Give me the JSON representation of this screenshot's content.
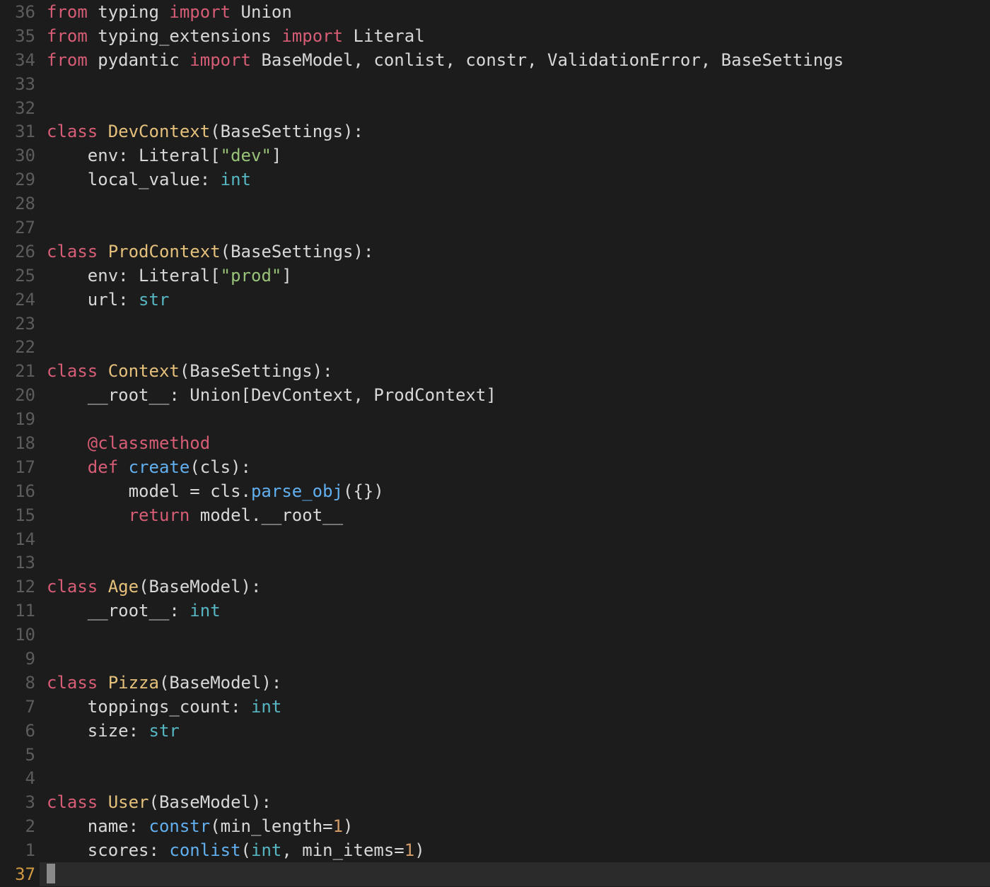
{
  "current_line_index": 36,
  "lines": [
    {
      "num": "36",
      "tokens": [
        {
          "cls": "tk-kw1",
          "t": "from"
        },
        {
          "cls": "tk-def",
          "t": " typing "
        },
        {
          "cls": "tk-kw1",
          "t": "import"
        },
        {
          "cls": "tk-def",
          "t": " Union"
        }
      ]
    },
    {
      "num": "35",
      "tokens": [
        {
          "cls": "tk-kw1",
          "t": "from"
        },
        {
          "cls": "tk-def",
          "t": " typing_extensions "
        },
        {
          "cls": "tk-kw1",
          "t": "import"
        },
        {
          "cls": "tk-def",
          "t": " Literal"
        }
      ]
    },
    {
      "num": "34",
      "tokens": [
        {
          "cls": "tk-kw1",
          "t": "from"
        },
        {
          "cls": "tk-def",
          "t": " pydantic "
        },
        {
          "cls": "tk-kw1",
          "t": "import"
        },
        {
          "cls": "tk-def",
          "t": " BaseModel, conlist, constr, ValidationError, BaseSettings"
        }
      ]
    },
    {
      "num": "33",
      "tokens": []
    },
    {
      "num": "32",
      "tokens": []
    },
    {
      "num": "31",
      "tokens": [
        {
          "cls": "tk-kw1",
          "t": "class"
        },
        {
          "cls": "tk-def",
          "t": " "
        },
        {
          "cls": "tk-cls",
          "t": "DevContext"
        },
        {
          "cls": "tk-def",
          "t": "(BaseSettings):"
        }
      ]
    },
    {
      "num": "30",
      "tokens": [
        {
          "cls": "tk-def",
          "t": "    env: Literal["
        },
        {
          "cls": "tk-str",
          "t": "\"dev\""
        },
        {
          "cls": "tk-def",
          "t": "]"
        }
      ]
    },
    {
      "num": "29",
      "tokens": [
        {
          "cls": "tk-def",
          "t": "    local_value: "
        },
        {
          "cls": "tk-type",
          "t": "int"
        }
      ]
    },
    {
      "num": "28",
      "tokens": []
    },
    {
      "num": "27",
      "tokens": []
    },
    {
      "num": "26",
      "tokens": [
        {
          "cls": "tk-kw1",
          "t": "class"
        },
        {
          "cls": "tk-def",
          "t": " "
        },
        {
          "cls": "tk-cls",
          "t": "ProdContext"
        },
        {
          "cls": "tk-def",
          "t": "(BaseSettings):"
        }
      ]
    },
    {
      "num": "25",
      "tokens": [
        {
          "cls": "tk-def",
          "t": "    env: Literal["
        },
        {
          "cls": "tk-str",
          "t": "\"prod\""
        },
        {
          "cls": "tk-def",
          "t": "]"
        }
      ]
    },
    {
      "num": "24",
      "tokens": [
        {
          "cls": "tk-def",
          "t": "    url: "
        },
        {
          "cls": "tk-type",
          "t": "str"
        }
      ]
    },
    {
      "num": "23",
      "tokens": []
    },
    {
      "num": "22",
      "tokens": []
    },
    {
      "num": "21",
      "tokens": [
        {
          "cls": "tk-kw1",
          "t": "class"
        },
        {
          "cls": "tk-def",
          "t": " "
        },
        {
          "cls": "tk-cls",
          "t": "Context"
        },
        {
          "cls": "tk-def",
          "t": "(BaseSettings):"
        }
      ]
    },
    {
      "num": "20",
      "tokens": [
        {
          "cls": "tk-def",
          "t": "    __root__: Union[DevContext, ProdContext]"
        }
      ]
    },
    {
      "num": "19",
      "tokens": []
    },
    {
      "num": "18",
      "tokens": [
        {
          "cls": "tk-def",
          "t": "    "
        },
        {
          "cls": "tk-decor",
          "t": "@classmethod"
        }
      ]
    },
    {
      "num": "17",
      "tokens": [
        {
          "cls": "tk-def",
          "t": "    "
        },
        {
          "cls": "tk-kw1",
          "t": "def"
        },
        {
          "cls": "tk-def",
          "t": " "
        },
        {
          "cls": "tk-fn",
          "t": "create"
        },
        {
          "cls": "tk-def",
          "t": "(cls):"
        }
      ]
    },
    {
      "num": "16",
      "tokens": [
        {
          "cls": "tk-def",
          "t": "        model = cls."
        },
        {
          "cls": "tk-fn",
          "t": "parse_obj"
        },
        {
          "cls": "tk-def",
          "t": "({})"
        }
      ]
    },
    {
      "num": "15",
      "tokens": [
        {
          "cls": "tk-def",
          "t": "        "
        },
        {
          "cls": "tk-kw1",
          "t": "return"
        },
        {
          "cls": "tk-def",
          "t": " model.__root__"
        }
      ]
    },
    {
      "num": "14",
      "tokens": []
    },
    {
      "num": "13",
      "tokens": []
    },
    {
      "num": "12",
      "tokens": [
        {
          "cls": "tk-kw1",
          "t": "class"
        },
        {
          "cls": "tk-def",
          "t": " "
        },
        {
          "cls": "tk-cls",
          "t": "Age"
        },
        {
          "cls": "tk-def",
          "t": "(BaseModel):"
        }
      ]
    },
    {
      "num": "11",
      "tokens": [
        {
          "cls": "tk-def",
          "t": "    __root__: "
        },
        {
          "cls": "tk-type",
          "t": "int"
        }
      ]
    },
    {
      "num": "10",
      "tokens": []
    },
    {
      "num": "9",
      "tokens": []
    },
    {
      "num": "8",
      "tokens": [
        {
          "cls": "tk-kw1",
          "t": "class"
        },
        {
          "cls": "tk-def",
          "t": " "
        },
        {
          "cls": "tk-cls",
          "t": "Pizza"
        },
        {
          "cls": "tk-def",
          "t": "(BaseModel):"
        }
      ]
    },
    {
      "num": "7",
      "tokens": [
        {
          "cls": "tk-def",
          "t": "    toppings_count: "
        },
        {
          "cls": "tk-type",
          "t": "int"
        }
      ]
    },
    {
      "num": "6",
      "tokens": [
        {
          "cls": "tk-def",
          "t": "    size: "
        },
        {
          "cls": "tk-type",
          "t": "str"
        }
      ]
    },
    {
      "num": "5",
      "tokens": []
    },
    {
      "num": "4",
      "tokens": []
    },
    {
      "num": "3",
      "tokens": [
        {
          "cls": "tk-kw1",
          "t": "class"
        },
        {
          "cls": "tk-def",
          "t": " "
        },
        {
          "cls": "tk-cls",
          "t": "User"
        },
        {
          "cls": "tk-def",
          "t": "(BaseModel):"
        }
      ]
    },
    {
      "num": "2",
      "tokens": [
        {
          "cls": "tk-def",
          "t": "    name: "
        },
        {
          "cls": "tk-fn",
          "t": "constr"
        },
        {
          "cls": "tk-def",
          "t": "(min_length="
        },
        {
          "cls": "tk-num",
          "t": "1"
        },
        {
          "cls": "tk-def",
          "t": ")"
        }
      ]
    },
    {
      "num": "1",
      "tokens": [
        {
          "cls": "tk-def",
          "t": "    scores: "
        },
        {
          "cls": "tk-fn",
          "t": "conlist"
        },
        {
          "cls": "tk-def",
          "t": "("
        },
        {
          "cls": "tk-type",
          "t": "int"
        },
        {
          "cls": "tk-def",
          "t": ", min_items="
        },
        {
          "cls": "tk-num",
          "t": "1"
        },
        {
          "cls": "tk-def",
          "t": ")"
        }
      ]
    },
    {
      "num": "37",
      "current": true,
      "tokens": [
        {
          "cls": "cursor",
          "t": ""
        }
      ]
    }
  ]
}
